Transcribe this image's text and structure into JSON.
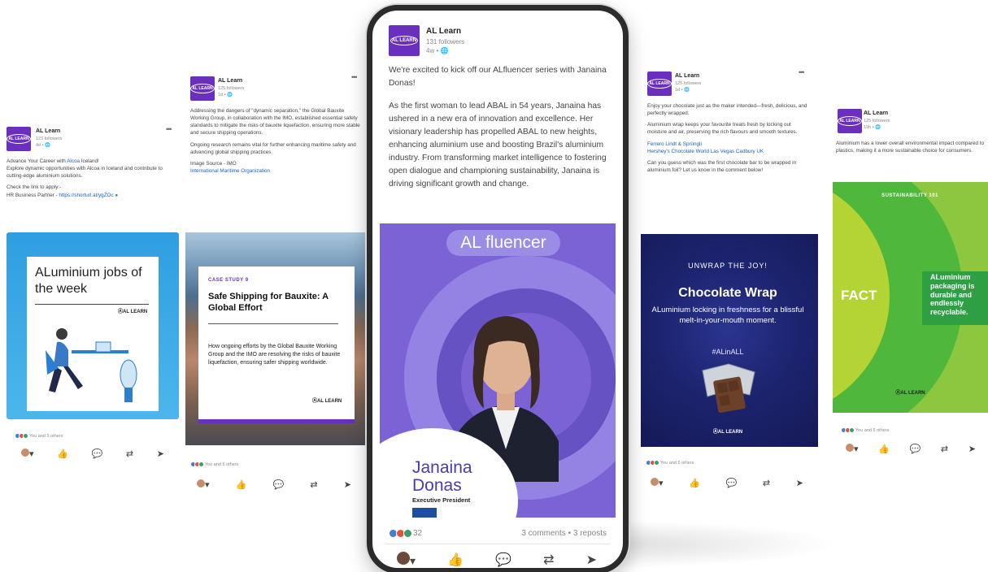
{
  "company": {
    "name": "AL Learn",
    "logo_text": "AL LEARN"
  },
  "post1": {
    "followers": "123 followers",
    "time": "4d • ",
    "line1_pre": "Advance Your Career with ",
    "line1_link": "Alcoa",
    "line1_post": " Iceland!",
    "line2": "Explore dynamic opportunities with Alcoa in Iceland and contribute to cutting-edge aluminium solutions.",
    "line3": "Check the link to apply:-",
    "line4_pre": "HR Business Partner - ",
    "line4_link": "https://shorturl.at/ygZOc",
    "card_title": "ALuminium jobs of the week",
    "reactions": "You and 5 others"
  },
  "post2": {
    "followers": "125 followers",
    "time": "1d • ",
    "para1": "Addressing the dangers of \"dynamic separation,\" the Global Bauxite Working Group, in collaboration with the IMO, established essential safety standards to mitigate the risks of bauxite liquefaction, ensuring more stable and secure shipping operations.",
    "para2": "Ongoing research remains vital for further enhancing maritime safety and advancing global shipping practices.",
    "source_label": "Image Source - IMO",
    "source_link": "International Maritime Organization",
    "case_label": "CASE STUDY 9",
    "case_title": "Safe Shipping for Bauxite: A Global Effort",
    "case_body": "How ongoing efforts by the Global Bauxite Working Group and the IMO are resolving the risks of bauxite liquefaction, ensuring safer shipping worldwide.",
    "reactions": "You and 6 others"
  },
  "post3": {
    "followers": "131 followers",
    "time": "4w • ",
    "para1": "We're excited to kick off our ALfluencer series with Janaina Donas!",
    "para2": "As the first woman to lead ABAL in 54 years, Janaina has ushered in a new era of innovation and excellence. Her visionary leadership has propelled ABAL to new heights, enhancing aluminium use and boosting Brazil's aluminium industry. From transforming market intelligence to fostering open dialogue and championing sustainability, Janaina is driving significant growth and change.",
    "banner": "AL fluencer",
    "person_name": "Janaina Donas",
    "person_role": "Executive President",
    "reaction_count": "32",
    "stats": "3 comments • 3 reposts"
  },
  "post4": {
    "followers": "125 followers",
    "time": "1d • ",
    "para1": "Enjoy your chocolate just as the maker intended—fresh, delicious, and perfectly wrapped.",
    "para2": "Aluminium wrap keeps your favourite treats fresh by locking out moisture and air, preserving the rich flavours and smooth textures.",
    "tags_line1": "Ferrero  Lindt & Sprüngli",
    "tags_line2": "Hershey's  Chocolate World Las Vegas  Cadbury UK",
    "para3": "Can you guess which was the first chocolate bar to be wrapped in aluminium foil? Let us know in the comment below!",
    "card_kicker": "UNWRAP THE JOY!",
    "card_title": "Chocolate Wrap",
    "card_body": "ALuminium locking in freshness for a blissful melt-in-your-mouth moment.",
    "card_tag": "#ALinALL",
    "reactions": "You and 6 others"
  },
  "post5": {
    "followers": "125 followers",
    "time": "19h • ",
    "para1": "Aluminium has a lower overall environmental impact compared to plastics, making it a more sustainable choice for consumers.",
    "card_kicker": "SUSTAINABILITY 101",
    "card_word": "FACT",
    "card_fact": "ALuminium packaging is durable and endlessly recyclable.",
    "reactions": "You and 5 others"
  },
  "colors": {
    "brand_purple": "#6a2fbf",
    "link_blue": "#1a5fc2",
    "chocolate_navy": "#1d2470",
    "green": "#4fb83c"
  }
}
